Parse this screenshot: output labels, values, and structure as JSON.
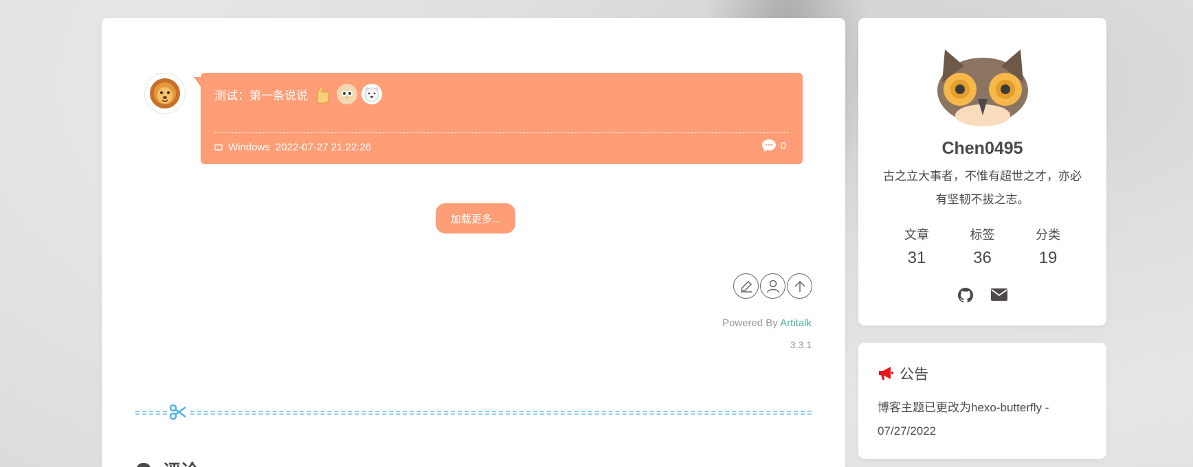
{
  "talk": {
    "text": "测试：第一条说说",
    "os": "Windows",
    "datetime": "2022-07-27 21:22:26",
    "comment_count": "0"
  },
  "load_more": "加载更多...",
  "powered": {
    "prefix": "Powered By ",
    "link": "Artitalk",
    "version": "3.3.1"
  },
  "comments": {
    "title": "评论"
  },
  "profile": {
    "name": "Chen0495",
    "description": "古之立大事者，不惟有超世之才，亦必有坚韧不拔之志。",
    "stats": [
      {
        "label": "文章",
        "value": "31"
      },
      {
        "label": "标签",
        "value": "36"
      },
      {
        "label": "分类",
        "value": "19"
      }
    ]
  },
  "announcement": {
    "title": "公告",
    "content": "博客主题已更改为hexo-butterfly - 07/27/2022",
    "icon_color": "#e6161e"
  },
  "colors": {
    "accent": "#ff9d76",
    "link": "#49b1a5"
  }
}
